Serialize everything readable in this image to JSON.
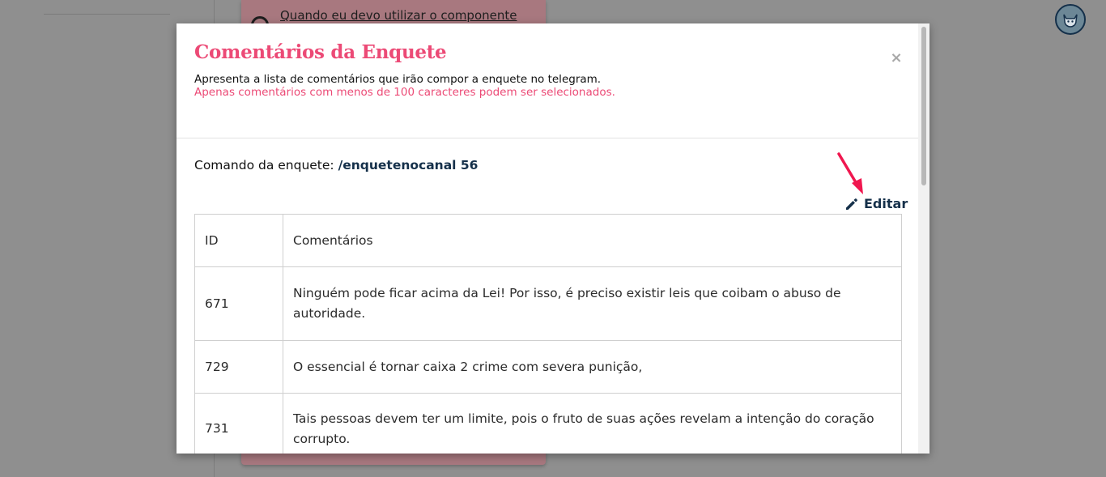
{
  "background": {
    "card_link": "Quando eu devo utilizar o componente"
  },
  "modal": {
    "title": "Comentários da Enquete",
    "description": "Apresenta a lista de comentários que irão compor a enquete no telegram.",
    "note": "Apenas comentários com menos de 100 caracteres podem ser selecionados.",
    "close_label": "×",
    "command_label": "Comando da enquete:",
    "command_value": "/enquetenocanal 56",
    "edit_label": "Editar",
    "table": {
      "headers": [
        "ID",
        "Comentários"
      ],
      "rows": [
        {
          "id": "671",
          "comment": "Ninguém pode ficar acima da Lei! Por isso, é preciso existir leis que coibam o abuso de autoridade."
        },
        {
          "id": "729",
          "comment": "O essencial é tornar caixa 2 crime com severa punição,"
        },
        {
          "id": "731",
          "comment": "Tais pessoas devem ter um limite, pois o fruto de suas ações revelam a intenção do coração corrupto."
        }
      ]
    }
  },
  "icons": {
    "edit": "pencil-icon",
    "close": "close-icon",
    "avatar": "cat-avatar-icon",
    "annotation": "red-arrow-icon"
  },
  "colors": {
    "accent": "#ec4a76",
    "navy": "#15304a",
    "arrow": "#f0174f"
  }
}
